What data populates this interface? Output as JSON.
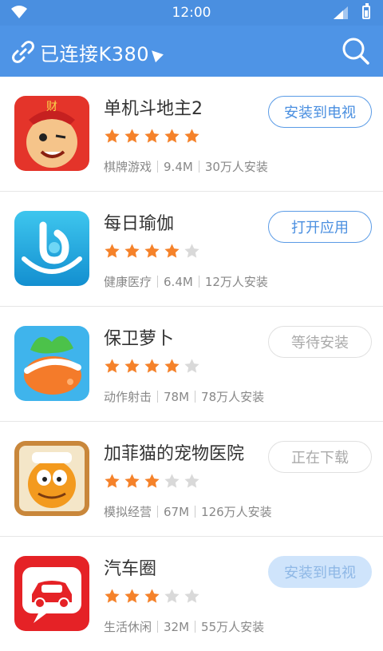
{
  "status_bar": {
    "time": "12:00"
  },
  "toolbar": {
    "title": "已连接K380"
  },
  "apps": [
    {
      "name": "单机斗地主2",
      "rating": 5,
      "category": "棋牌游戏",
      "size": "9.4M",
      "installs": "30万人安装",
      "action": "安装到电视",
      "action_state": "active"
    },
    {
      "name": "每日瑜伽",
      "rating": 4,
      "category": "健康医疗",
      "size": "6.4M",
      "installs": "12万人安装",
      "action": "打开应用",
      "action_state": "active"
    },
    {
      "name": "保卫萝卜",
      "rating": 4,
      "category": "动作射击",
      "size": "78M",
      "installs": "78万人安装",
      "action": "等待安装",
      "action_state": "disabled"
    },
    {
      "name": "加菲猫的宠物医院",
      "rating": 3,
      "category": "模拟经营",
      "size": "67M",
      "installs": "126万人安装",
      "action": "正在下载",
      "action_state": "disabled"
    },
    {
      "name": "汽车圈",
      "rating": 3,
      "category": "生活休闲",
      "size": "32M",
      "installs": "55万人安装",
      "action": "安装到电视",
      "action_state": "filled"
    }
  ],
  "colors": {
    "accent": "#4e94e6",
    "star_on": "#f5822a",
    "star_off": "#d9d9d9"
  }
}
